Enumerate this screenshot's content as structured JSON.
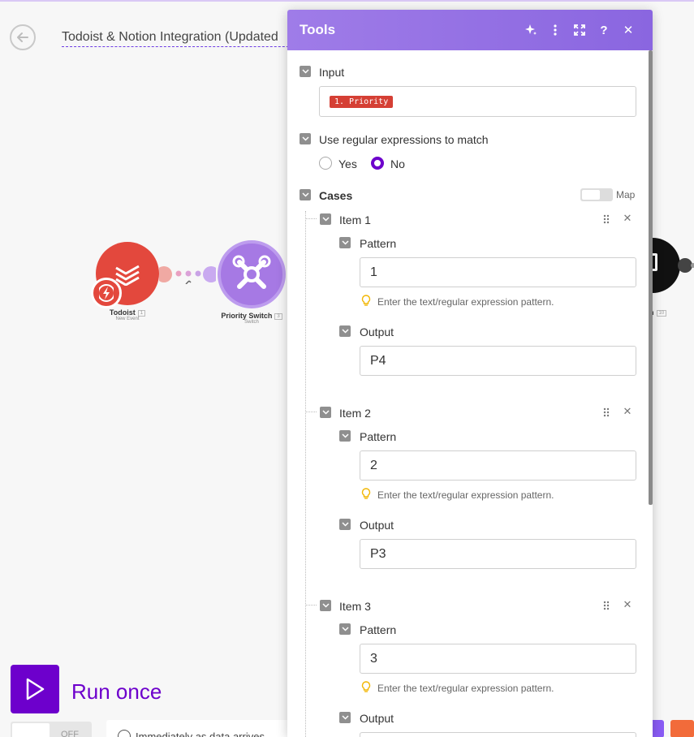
{
  "scenario": {
    "title": "Todoist & Notion Integration (Updated"
  },
  "modules": {
    "todoist": {
      "label": "Todoist",
      "id": "1",
      "subtitle": "New Event"
    },
    "priority_switch": {
      "label": "Priority Switch",
      "id": "3",
      "subtitle": "Switch"
    },
    "right_partial": {
      "label": "n",
      "id": "10"
    }
  },
  "toolbar": {
    "run_once_label": "Run once",
    "schedule_toggle_label": "OFF",
    "schedule_info": "Immediately as data arrives"
  },
  "dialog": {
    "title": "Tools",
    "input_label": "Input",
    "input_pill": "1. Priority",
    "regex_label": "Use regular expressions to match",
    "regex_options": [
      "Yes",
      "No"
    ],
    "regex_selected": "No",
    "cases_label": "Cases",
    "map_label": "Map",
    "pattern_hint": "Enter the text/regular expression pattern.",
    "items": [
      {
        "label": "Item 1",
        "pattern_label": "Pattern",
        "pattern_value": "1",
        "output_label": "Output",
        "output_value": "P4"
      },
      {
        "label": "Item 2",
        "pattern_label": "Pattern",
        "pattern_value": "2",
        "output_label": "Output",
        "output_value": "P3"
      },
      {
        "label": "Item 3",
        "pattern_label": "Pattern",
        "pattern_value": "3",
        "output_label": "Output",
        "output_value": ""
      }
    ]
  },
  "colors": {
    "accent": "#6d00cc",
    "header": "#9577e6",
    "todoist": "#e3483d",
    "switch": "#a679e4"
  }
}
